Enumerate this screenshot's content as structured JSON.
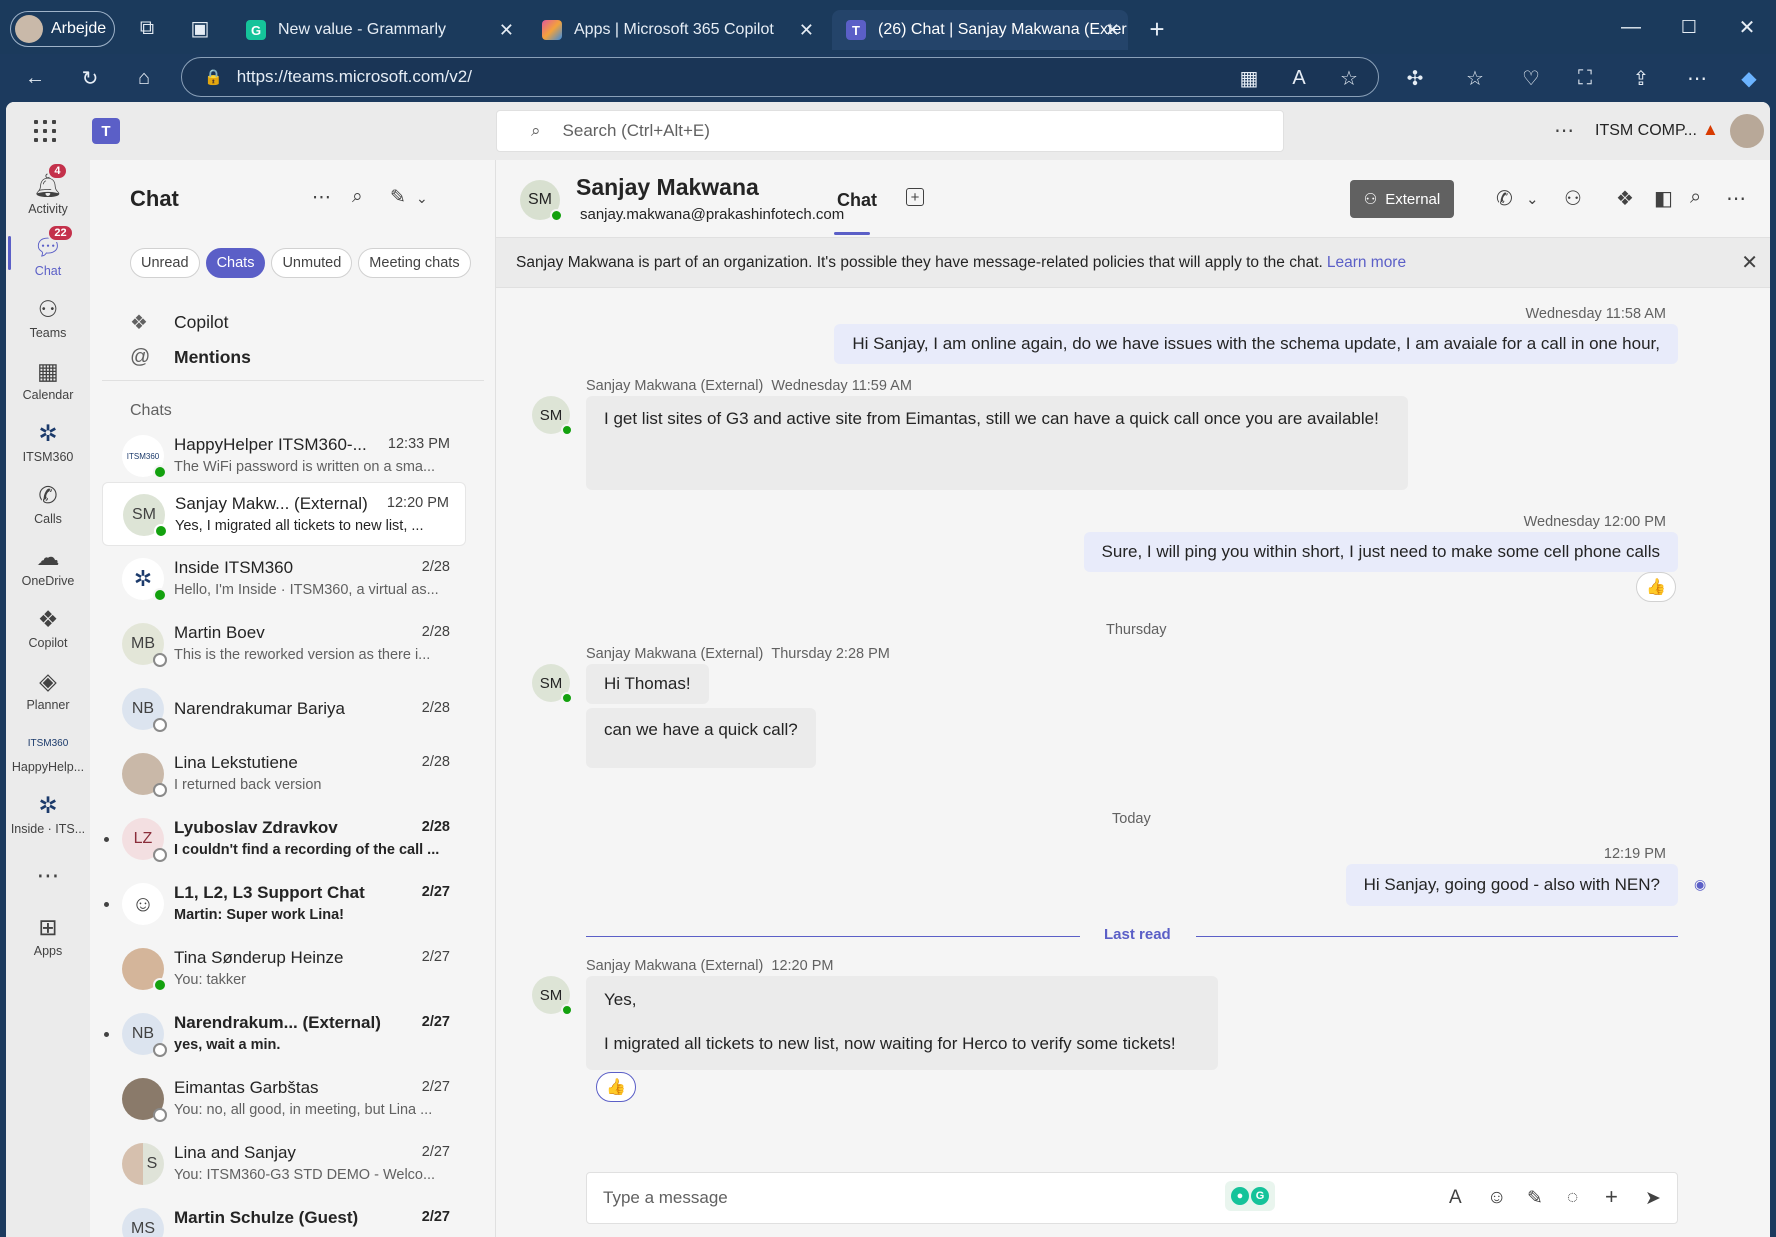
{
  "browser": {
    "profile_name": "Arbejde",
    "tabs": [
      {
        "label": "New value - Grammarly",
        "favicon": "G"
      },
      {
        "label": "Apps | Microsoft 365 Copilot",
        "favicon": ""
      },
      {
        "label": "(26) Chat | Sanjay Makwana (Exter",
        "favicon": ""
      }
    ],
    "url": "https://teams.microsoft.com/v2/"
  },
  "teams": {
    "logo": "T",
    "search_placeholder": "Search (Ctrl+Alt+E)",
    "org_name": "ITSM COMP...",
    "rail": [
      {
        "label": "Activity",
        "badge": "4",
        "icon": "bell-icon"
      },
      {
        "label": "Chat",
        "badge": "22",
        "icon": "chat-icon"
      },
      {
        "label": "Teams",
        "badge": "",
        "icon": "teams-icon"
      },
      {
        "label": "Calendar",
        "badge": "",
        "icon": "calendar-icon"
      },
      {
        "label": "ITSM360",
        "badge": "",
        "icon": "itsm360-icon"
      },
      {
        "label": "Calls",
        "badge": "",
        "icon": "phone-icon"
      },
      {
        "label": "OneDrive",
        "badge": "",
        "icon": "cloud-icon"
      },
      {
        "label": "Copilot",
        "badge": "",
        "icon": "copilot-icon"
      },
      {
        "label": "Planner",
        "badge": "",
        "icon": "planner-icon"
      },
      {
        "label": "HappyHelp...",
        "badge": "",
        "icon": "happyhelper-icon"
      },
      {
        "label": "Inside · ITS...",
        "badge": "",
        "icon": "inside-itsm-icon"
      },
      {
        "label": "Apps",
        "badge": "",
        "icon": "apps-icon"
      }
    ]
  },
  "chatlist": {
    "title": "Chat",
    "filters": [
      "Unread",
      "Chats",
      "Unmuted",
      "Meeting chats"
    ],
    "pinned": [
      {
        "label": "Copilot",
        "icon": "copilot-icon"
      },
      {
        "label": "Mentions",
        "icon": "at-icon"
      }
    ],
    "section": "Chats",
    "items": [
      {
        "name": "HappyHelper ITSM360-...",
        "time": "12:33 PM",
        "preview": "The WiFi password is written on a sma...",
        "initials": "",
        "presence": "on",
        "unread": false
      },
      {
        "name": "Sanjay Makw...  (External)",
        "time": "12:20 PM",
        "preview": "Yes,   I migrated all tickets to new list, ...",
        "initials": "SM",
        "presence": "on",
        "unread": false
      },
      {
        "name": "Inside ITSM360",
        "time": "2/28",
        "preview": "Hello, I'm Inside · ITSM360, a virtual as...",
        "initials": "",
        "presence": "on",
        "unread": false
      },
      {
        "name": "Martin Boev",
        "time": "2/28",
        "preview": "This is the reworked version as there i...",
        "initials": "MB",
        "presence": "off",
        "unread": false
      },
      {
        "name": "Narendrakumar Bariya",
        "time": "2/28",
        "preview": "",
        "initials": "NB",
        "presence": "off",
        "unread": false
      },
      {
        "name": "Lina Lekstutiene",
        "time": "2/28",
        "preview": "I returned back version",
        "initials": "",
        "presence": "off",
        "unread": false
      },
      {
        "name": "Lyuboslav Zdravkov",
        "time": "2/28",
        "preview": "I couldn't find a recording of the call ...",
        "initials": "LZ",
        "presence": "off",
        "unread": true
      },
      {
        "name": "L1, L2, L3 Support Chat",
        "time": "2/27",
        "preview": "Martin: Super work Lina!",
        "initials": "",
        "presence": "",
        "unread": true
      },
      {
        "name": "Tina Sønderup Heinze",
        "time": "2/27",
        "preview": "You: takker",
        "initials": "",
        "presence": "on",
        "unread": false
      },
      {
        "name": "Narendrakum...  (External)",
        "time": "2/27",
        "preview": "yes,  wait a min.",
        "initials": "NB",
        "presence": "off",
        "unread": true
      },
      {
        "name": "Eimantas Garbštas",
        "time": "2/27",
        "preview": "You: no, all good, in meeting, but Lina ...",
        "initials": "",
        "presence": "off",
        "unread": false
      },
      {
        "name": "Lina and Sanjay",
        "time": "2/27",
        "preview": "You: ITSM360-G3 STD DEMO - Welco...",
        "initials": "S",
        "presence": "",
        "unread": false
      },
      {
        "name": "Martin Schulze (Guest)",
        "time": "2/27",
        "preview": "",
        "initials": "MS",
        "presence": "",
        "unread": true
      }
    ]
  },
  "conversation": {
    "contact_initials": "SM",
    "contact_name": "Sanjay Makwana",
    "contact_email": "sanjay.makwana@prakashinfotech.com",
    "tab_label": "Chat",
    "external_label": "External",
    "banner_text": "Sanjay Makwana is part of an organization. It's possible they have message-related policies that will apply to the chat.",
    "banner_link": "Learn more",
    "messages": [
      {
        "time": "Wednesday 11:58 AM",
        "text": "Hi Sanjay, I am online again, do we have issues with the schema update, I am avaiale for a call in one hour,"
      },
      {
        "sender": "Sanjay Makwana (External)",
        "time": "Wednesday 11:59 AM",
        "text": "I get list sites of G3 and active site from Eimantas, still we can have a quick call once you are available!"
      },
      {
        "time": "Wednesday 12:00 PM",
        "text": "Sure, I will ping you within short, I just need to make some cell phone calls",
        "reaction": "👍"
      },
      {
        "sender": "Sanjay Makwana (External)",
        "time": "Thursday 2:28 PM",
        "text": "Hi Thomas!",
        "text2": "can we have a quick call?"
      },
      {
        "time": "12:19 PM",
        "text": "Hi Sanjay, going good - also with NEN?"
      },
      {
        "sender": "Sanjay Makwana (External)",
        "time": "12:20 PM",
        "text": "Yes,",
        "text2": "I migrated all tickets to new list, now waiting for Herco to verify some tickets!",
        "reaction": "👍"
      }
    ],
    "day_labels": [
      "Thursday",
      "Today"
    ],
    "last_read": "Last read",
    "composer_placeholder": "Type a message"
  }
}
